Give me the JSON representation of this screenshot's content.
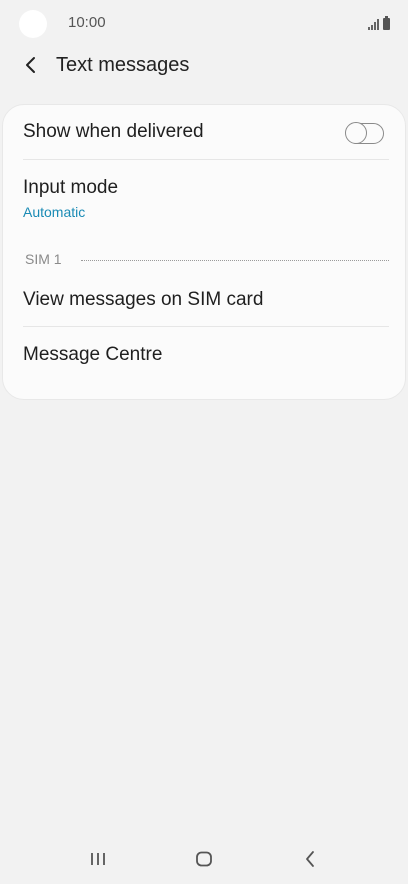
{
  "status_bar": {
    "time": "10:00",
    "icons": [
      "signal-icon",
      "battery-icon"
    ]
  },
  "app_bar": {
    "back_icon": "chevron-left-icon",
    "title": "Text messages"
  },
  "settings": {
    "show_when_delivered": {
      "label": "Show when delivered",
      "toggle_on": false
    },
    "input_mode": {
      "label": "Input mode",
      "value": "Automatic"
    },
    "section_sim": {
      "label": "SIM 1"
    },
    "view_messages_sim": {
      "label": "View messages on SIM card"
    },
    "message_centre": {
      "label": "Message Centre"
    }
  },
  "nav_bar": {
    "icons": [
      "recent-apps-icon",
      "home-icon",
      "back-icon"
    ]
  },
  "colors": {
    "background": "#f2f2f2",
    "card": "#fbfbfb",
    "accent": "#1a8bb5",
    "secondary_text": "#8a8a8a"
  }
}
